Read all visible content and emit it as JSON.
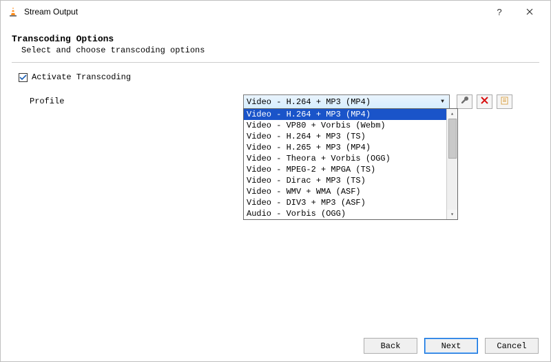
{
  "window": {
    "title": "Stream Output"
  },
  "header": {
    "title": "Transcoding Options",
    "desc": "Select and choose transcoding options"
  },
  "activate": {
    "label": "Activate Transcoding",
    "checked": true
  },
  "profile": {
    "label": "Profile",
    "selected": "Video - H.264 + MP3 (MP4)",
    "options": [
      "Video - H.264 + MP3 (MP4)",
      "Video - VP80 + Vorbis (Webm)",
      "Video - H.264 + MP3 (TS)",
      "Video - H.265 + MP3 (MP4)",
      "Video - Theora + Vorbis (OGG)",
      "Video - MPEG-2 + MPGA (TS)",
      "Video - Dirac + MP3 (TS)",
      "Video - WMV + WMA (ASF)",
      "Video - DIV3 + MP3 (ASF)",
      "Audio - Vorbis (OGG)"
    ]
  },
  "buttons": {
    "back": "Back",
    "next": "Next",
    "cancel": "Cancel"
  }
}
